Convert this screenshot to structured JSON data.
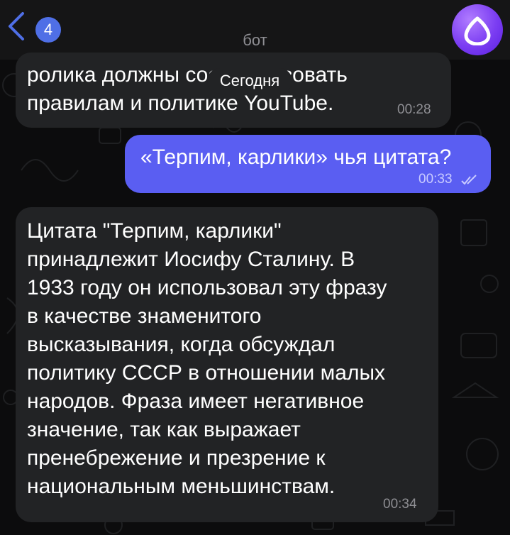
{
  "header": {
    "unread_count": "4",
    "chat_title": "бот",
    "accent_color": "#4f6fe6",
    "avatar_icon": "bot-logo-icon"
  },
  "date_separator": "Сегодня",
  "messages": [
    {
      "direction": "incoming",
      "text": "ролика должны соответствовать\nправилам и политике YouTube.",
      "time": "00:28"
    },
    {
      "direction": "outgoing",
      "text": "«Терпим, карлики» чья цитата?",
      "time": "00:33",
      "status_icon": "double-check-icon"
    },
    {
      "direction": "incoming",
      "text": "Цитата \"Терпим, карлики\"\nпринадлежит Иосифу Сталину. В\n1933 году он использовал эту фразу\nв качестве знаменитого\nвысказывания, когда обсуждал\nполитику СССР в отношении малых\nнародов. Фраза имеет негативное\nзначение, так как выражает\nпренебрежение и презрение к\nнациональным меньшинствам.",
      "time": "00:34"
    }
  ]
}
